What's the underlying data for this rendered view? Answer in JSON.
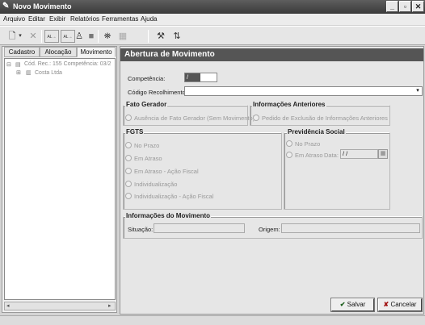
{
  "window": {
    "title": "Novo Movimento",
    "controls": {
      "minimize": "_",
      "maximize": "▫",
      "close": "✕"
    }
  },
  "menu": [
    "Arquivo",
    "Editar",
    "Exibir",
    "Relatórios",
    "Ferramentas",
    "Ajuda"
  ],
  "toolbar": {
    "icons": [
      "new-document-icon",
      "dropdown-arrow-icon",
      "delete-icon",
      "text-small-icon",
      "text-large-icon",
      "person-icon",
      "stop-icon",
      "binoculars-icon",
      "calculator-icon",
      "tools-icon",
      "sort-icon"
    ],
    "text_small": "AL→",
    "text_large": "AL→"
  },
  "left": {
    "tabs": [
      "Cadastro",
      "Alocação",
      "Movimento"
    ],
    "active_tab": "Movimento",
    "tree": [
      {
        "label": "Cód. Rec.: 155 Competência: 03/2",
        "level": 0
      },
      {
        "label": "Costa Ltda",
        "level": 1
      }
    ]
  },
  "form": {
    "header": "Abertura de Movimento",
    "competencia_label": "Competência:",
    "competencia_value": "  /",
    "codigo_label": "Código Recolhimento:",
    "codigo_value": "",
    "fato_gerador": {
      "title": "Fato Gerador",
      "option": "Ausência de Fato Gerador (Sem Movimento)"
    },
    "informacoes_anteriores": {
      "title": "Informações Anteriores",
      "option": "Pedido de Exclusão de Informações Anteriores"
    },
    "fgts": {
      "title": "FGTS",
      "options": [
        "No Prazo",
        "Em Atraso",
        "Em Atraso - Ação Fiscal",
        "Individualização",
        "Individualização - Ação Fiscal"
      ]
    },
    "previdencia": {
      "title": "Previdência Social",
      "options": [
        "No Prazo",
        "Em Atraso"
      ],
      "data_label": "Data:",
      "data_value": "  /  /"
    },
    "informacoes_movimento": {
      "title": "Informações do Movimento",
      "situacao_label": "Situação:",
      "situacao_value": "",
      "origem_label": "Origem:",
      "origem_value": ""
    },
    "buttons": {
      "salvar": "Salvar",
      "cancelar": "Cancelar"
    }
  },
  "colors": {
    "titlebar": "#4a4a4a",
    "header_band": "#555555",
    "panel": "#e6e6e6"
  }
}
